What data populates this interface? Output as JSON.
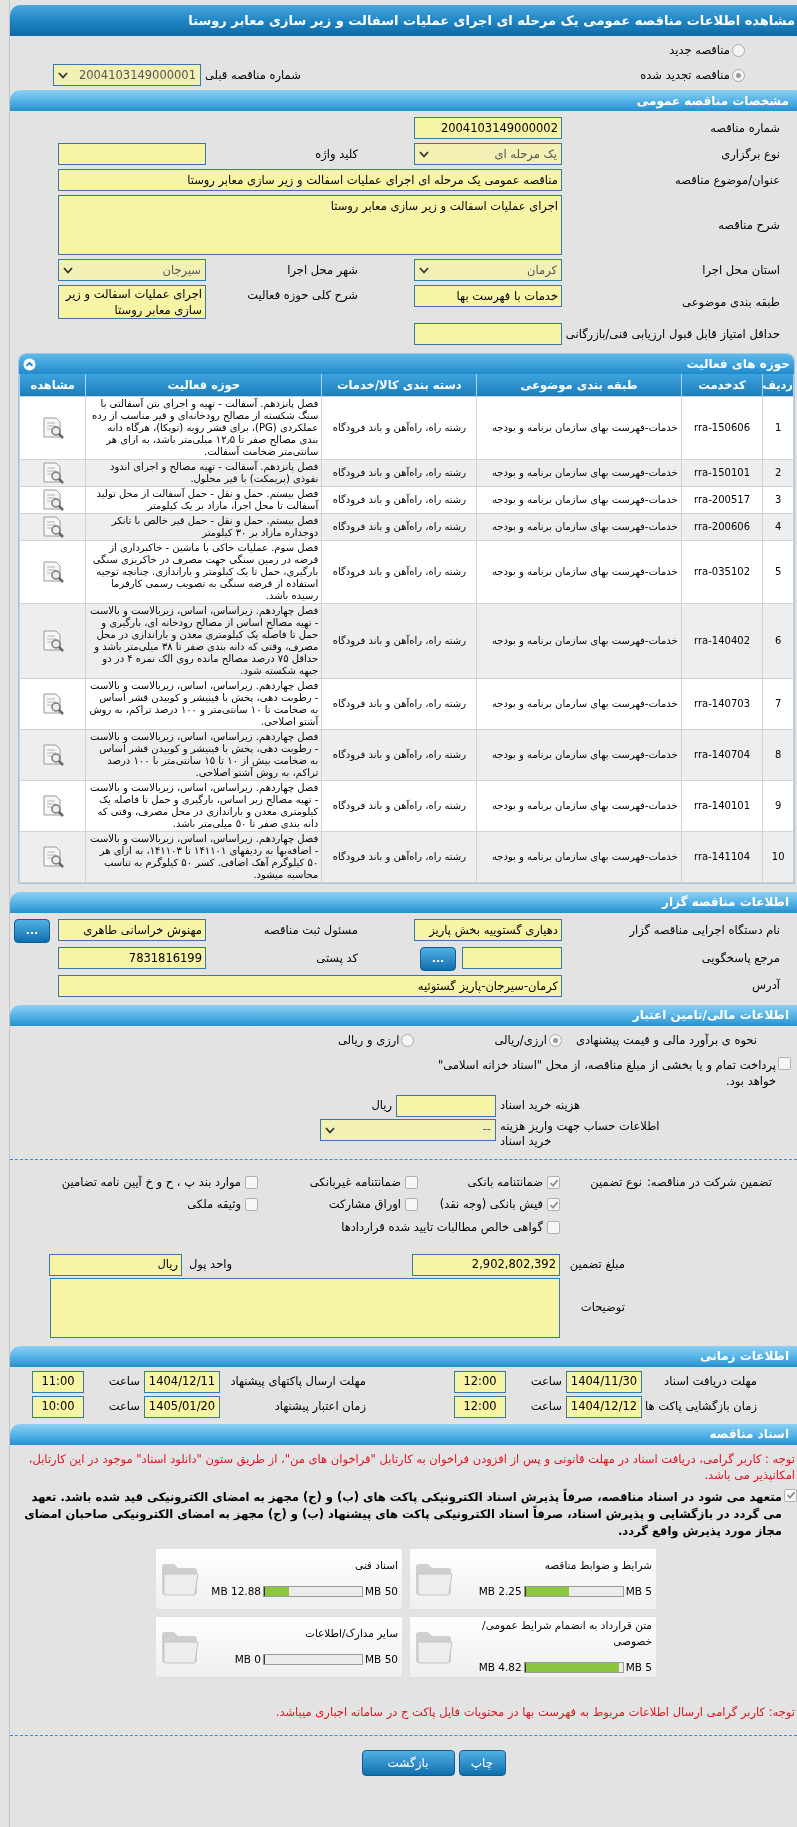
{
  "title": "مشاهده اطلاعات مناقصه عمومی یک مرحله ای اجرای عملیات اسفالت و زیر سازی معابر روستا",
  "tender_status": [
    {
      "label": "مناقصه جدید",
      "selected": false
    },
    {
      "label": "مناقصه تجدید شده",
      "selected": true
    }
  ],
  "previous_tender": {
    "label": "شماره مناقصه قبلی",
    "value": "2004103149000001"
  },
  "general": {
    "header": "مشخصات مناقصه عمومی",
    "rows": [
      [
        {
          "kind": "text",
          "label": "شماره مناقصه",
          "value": "2004103149000002"
        }
      ],
      [
        {
          "kind": "select",
          "label": "نوع برگزاری",
          "value": "یک مرحله ای"
        },
        {
          "kind": "text",
          "label": "کلید واژه"
        }
      ],
      [
        {
          "kind": "wide",
          "label": "عنوان/موضوع مناقصه",
          "value": "مناقصه عمومی یک مرحله ای اجرای عملیات اسفالت و زیر سازی معابر روستا"
        }
      ],
      [
        {
          "kind": "memo",
          "label": "شرح مناقصه",
          "value": "اجرای عملیات اسفالت و زیر سازی معابر روستا"
        }
      ],
      [
        {
          "kind": "select",
          "label": "استان محل اجرا",
          "value": "کرمان"
        },
        {
          "kind": "select",
          "label": "شهر محل اجرا",
          "value": "سیرجان"
        }
      ],
      [
        {
          "kind": "text",
          "label": "طبقه بندی موضوعی",
          "value": "خدمات با فهرست بها"
        },
        {
          "kind": "text",
          "label": "شرح کلی حوزه فعالیت",
          "value": "اجرای عملیات اسفالت و زیر سازی معابر روستا"
        }
      ],
      [
        {
          "kind": "text",
          "label": "حداقل امتیاز قابل قبول ارزیابی فنی/بازرگانی"
        }
      ]
    ]
  },
  "activities": {
    "header": "حوزه های فعالیت",
    "columns": [
      "ردیف",
      "کدخدمت",
      "طبقه بندی موضوعی",
      "دسته بندی کالا/خدمات",
      "حوزه فعالیت",
      "مشاهده"
    ],
    "rows": [
      {
        "index": "1",
        "code": "rra-150606",
        "category": "خدمات-فهرست بهای سازمان برنامه و بودجه",
        "group": "رشته راه، راه‌آهن و باند فرودگاه",
        "activity": "فصل پانزدهم. آسفالت - تهیه و اجرای بتن آسفالتی با سنگ شکسته از مصالح رودخانه‌ای و قیر مناسب از رده عملکردی (PG)، برای قشر رویه (توپکا)، هرگاه دانه بندی مصالح صفر تا ۱۲٫۵ میلی‌متر باشد، به ازای هر سانتی‌متر ضخامت آسفالت."
      },
      {
        "index": "2",
        "code": "rra-150101",
        "category": "خدمات-فهرست بهای سازمان برنامه و بودجه",
        "group": "رشته راه، راه‌آهن و باند فرودگاه",
        "activity": "فصل پانزدهم. آسفالت - تهیه مصالح و اجرای اندود نفوذی (پریمکت) با قیر محلول."
      },
      {
        "index": "3",
        "code": "rra-200517",
        "category": "خدمات-فهرست بهای سازمان برنامه و بودجه",
        "group": "رشته راه، راه‌آهن و باند فرودگاه",
        "activity": "فصل بیستم. حمل و نقل - حمل آسفالت از محل تولید آسفالت تا محل اجرا، مازاد بر یک کیلومتر"
      },
      {
        "index": "4",
        "code": "rra-200606",
        "category": "خدمات-فهرست بهای سازمان برنامه و بودجه",
        "group": "رشته راه، راه‌آهن و باند فرودگاه",
        "activity": "فصل بیستم. حمل و نقل - حمل قیر خالص با تانکر دوجداره مازاد بر ۳۰ کیلومتر"
      },
      {
        "index": "5",
        "code": "rra-035102",
        "category": "خدمات-فهرست بهای سازمان برنامه و بودجه",
        "group": "رشته راه، راه‌آهن و باند فرودگاه",
        "activity": "فصل سوم. عملیات خاکی با ماشین - خاکبرداری از قرضه در زمین سنگی جهت مصرف در خاکریزی سنگی بارگیری، حمل تا یک کیلومتر و باراندازی. چنانچه توجیه استفاده از قرضه سنگی به تصویب رسمی کارفرما رسیده باشد."
      },
      {
        "index": "6",
        "code": "rra-140402",
        "category": "خدمات-فهرست بهای سازمان برنامه و بودجه",
        "group": "رشته راه، راه‌آهن و باند فرودگاه",
        "activity": "فصل چهاردهم. زیراساس، اساس، زیربالاست و بالاست - تهیه مصالح اساس از مصالح رودخانه ای، بارگیری و حمل تا فاصله یک کیلومتری معدن و باراندازی در محل مصرف، وقتی که دانه بندی صفر تا ۳۸ میلی‌متر باشد و حداقل ۷۵ درصد مصالح مانده روی الک نمره ۴ در دو جبهه شکسته شود."
      },
      {
        "index": "7",
        "code": "rra-140703",
        "category": "خدمات-فهرست بهای سازمان برنامه و بودجه",
        "group": "رشته راه، راه‌آهن و باند فرودگاه",
        "activity": "فصل چهاردهم. زیراساس، اساس، زیربالاست و بالاست - رطوبت دهی، پخش با فینیشر و کوبیدن قشر اساس به ضخامت تا ۱۰ سانتی‌متر و ۱۰۰ درصد تراکم، به روش آشتو اصلاحی."
      },
      {
        "index": "8",
        "code": "rra-140704",
        "category": "خدمات-فهرست بهای سازمان برنامه و بودجه",
        "group": "رشته راه، راه‌آهن و باند فرودگاه",
        "activity": "فصل چهاردهم. زیراساس، اساس، زیربالاست و بالاست - رطوبت دهی، پخش با فینیشر و کوبیدن قشر اساس به ضخامت بیش از ۱۰ تا ۱۵ سانتی‌متر با ۱۰۰ درصد تراکم، به روش آشتو اصلاحی."
      },
      {
        "index": "9",
        "code": "rra-140101",
        "category": "خدمات-فهرست بهای سازمان برنامه و بودجه",
        "group": "رشته راه، راه‌آهن و باند فرودگاه",
        "activity": "فصل چهاردهم. زیراساس، اساس، زیربالاست و بالاست - تهیه مصالح زیر اساس، بارگیری و حمل تا فاصله یک کیلومتری معدن و باراندازی در محل مصرف، وقتی که دانه بندی صفر تا ۵۰ میلی‌متر باشد."
      },
      {
        "index": "10",
        "code": "rra-141104",
        "category": "خدمات-فهرست بهای سازمان برنامه و بودجه",
        "group": "رشته راه، راه‌آهن و باند فرودگاه",
        "activity": "فصل چهاردهم. زیراساس، اساس، زیربالاست و بالاست - اضافه‌بها به ردیفهای ۱۴۱۱۰۱ تا ۱۴۱۱۰۳، به ازای هر ۵۰ کیلوگرم آهک اضافی. کسر ۵۰ کیلوگرم به تناسب محاسبه میشود."
      }
    ]
  },
  "organizer": {
    "header": "اطلاعات مناقصه گزار",
    "rows": [
      [
        {
          "kind": "text",
          "label": "نام دستگاه اجرایی مناقصه گزار",
          "value": "دهیاری گستوییه بخش پاریز"
        },
        {
          "kind": "text",
          "label": "مسئول ثبت مناقصه",
          "value": "مهنوش خراسانی طاهری",
          "button": "..."
        }
      ],
      [
        {
          "kind": "text",
          "label": "مرجع پاسخگویی",
          "button": "..."
        },
        {
          "kind": "text",
          "label": "کد پستی",
          "value": "7831816199"
        }
      ],
      [
        {
          "kind": "wide",
          "label": "آدرس",
          "value": "کرمان-سیرجان-پاریز گستوئیه"
        }
      ]
    ]
  },
  "finance": {
    "header": "اطلاعات مالی/تامین اعتبار",
    "estimate": {
      "label": "نحوه ی برآورد مالی و قیمت پیشنهادی",
      "options": [
        {
          "label": "ارزی/ریالی",
          "selected": true
        },
        {
          "label": "ارزی و ریالی",
          "selected": false
        }
      ]
    },
    "treasury": {
      "label": "پرداخت تمام و یا بخشی از مبلغ مناقصه، از محل \"اسناد خزانه اسلامی\" خواهد بود.",
      "checked": false
    },
    "doc_fee": {
      "label": "هزینه خرید اسناد",
      "unit": "ریال"
    },
    "account": {
      "label": "اطلاعات حساب جهت واریز هزینه خرید اسناد",
      "value": "--"
    },
    "guarantee": {
      "label": "تضمین شرکت در مناقصه:",
      "type_label": "نوع تضمین",
      "options": [
        {
          "label": "ضمانتنامه بانکی",
          "checked": true
        },
        {
          "label": "ضمانتنامه غیربانکی",
          "checked": false
        },
        {
          "label": "موارد بند پ ، ح و خ آیین نامه تضامین",
          "checked": false
        },
        {
          "label": "فیش بانکی (وجه نقد)",
          "checked": true
        },
        {
          "label": "اوراق مشارکت",
          "checked": false
        },
        {
          "label": "وثیقه ملکی",
          "checked": false
        },
        {
          "label": "گواهی خالص مطالبات تایید شده قراردادها",
          "checked": false
        }
      ]
    },
    "amount": {
      "label": "مبلغ تضمین",
      "value": "2,902,802,392"
    },
    "currency": {
      "label": "واحد پول",
      "value": "ریال"
    },
    "notes": {
      "label": "توضیحات"
    }
  },
  "schedule": {
    "header": "اطلاعات زمانی",
    "items": [
      {
        "label": "مهلت دریافت اسناد",
        "date": "1404/11/30",
        "time_label": "ساعت",
        "time": "12:00"
      },
      {
        "label": "مهلت ارسال پاکتهای پیشنهاد",
        "date": "1404/12/11",
        "time_label": "ساعت",
        "time": "11:00"
      },
      {
        "label": "زمان بازگشایی پاکت ها",
        "date": "1404/12/12",
        "time_label": "ساعت",
        "time": "12:00"
      },
      {
        "label": "زمان اعتبار پیشنهاد",
        "date": "1405/01/20",
        "time_label": "ساعت",
        "time": "10:00"
      }
    ]
  },
  "documents": {
    "header": "اسناد مناقصه",
    "notice": "توجه : کاربر گرامی، دریافت اسناد در مهلت قانونی و پس از افزودن فراخوان به کارتابل \"فراخوان های من\"، از طریق ستون \"دانلود اسناد\" موجود در این کارتابل، امکانپذیر می باشد.",
    "commitment": {
      "text": "متعهد می شود در اسناد مناقصه، صرفاً پذیرش اسناد الکترونیکی پاکت های (ب) و (ج) مجهز به امضای الکترونیکی قید شده باشد. تعهد می گردد در بازگشایی و پذیرش اسناد، صرفاً اسناد الکترونیکی پاکت های پیشنهاد (ب) و (ج) مجهز به امضای الکترونیکی صاحبان امضای مجاز مورد پذیرش واقع گردد.",
      "checked": true
    },
    "files": [
      {
        "title": "شرایط و ضوابط مناقصه",
        "max": "5 MB",
        "used": "2.25 MB",
        "level": 0.45
      },
      {
        "title": "اسناد فنی",
        "max": "50 MB",
        "used": "12.88 MB",
        "level": 0.2576
      },
      {
        "title": "متن قرارداد به انضمام شرایط عمومی/خصوصی",
        "max": "5 MB",
        "used": "4.82 MB",
        "level": 0.964
      },
      {
        "title": "سایر مدارک/اطلاعات",
        "max": "50 MB",
        "used": "0 MB",
        "level": 0
      }
    ],
    "footer_notice": "توجه: کاربر گرامی ارسال اطلاعات مربوط به فهرست بها در محتویات فایل پاکت ج در سامانه اجباری میباشد."
  },
  "buttons": [
    "چاپ",
    "بازگشت"
  ]
}
